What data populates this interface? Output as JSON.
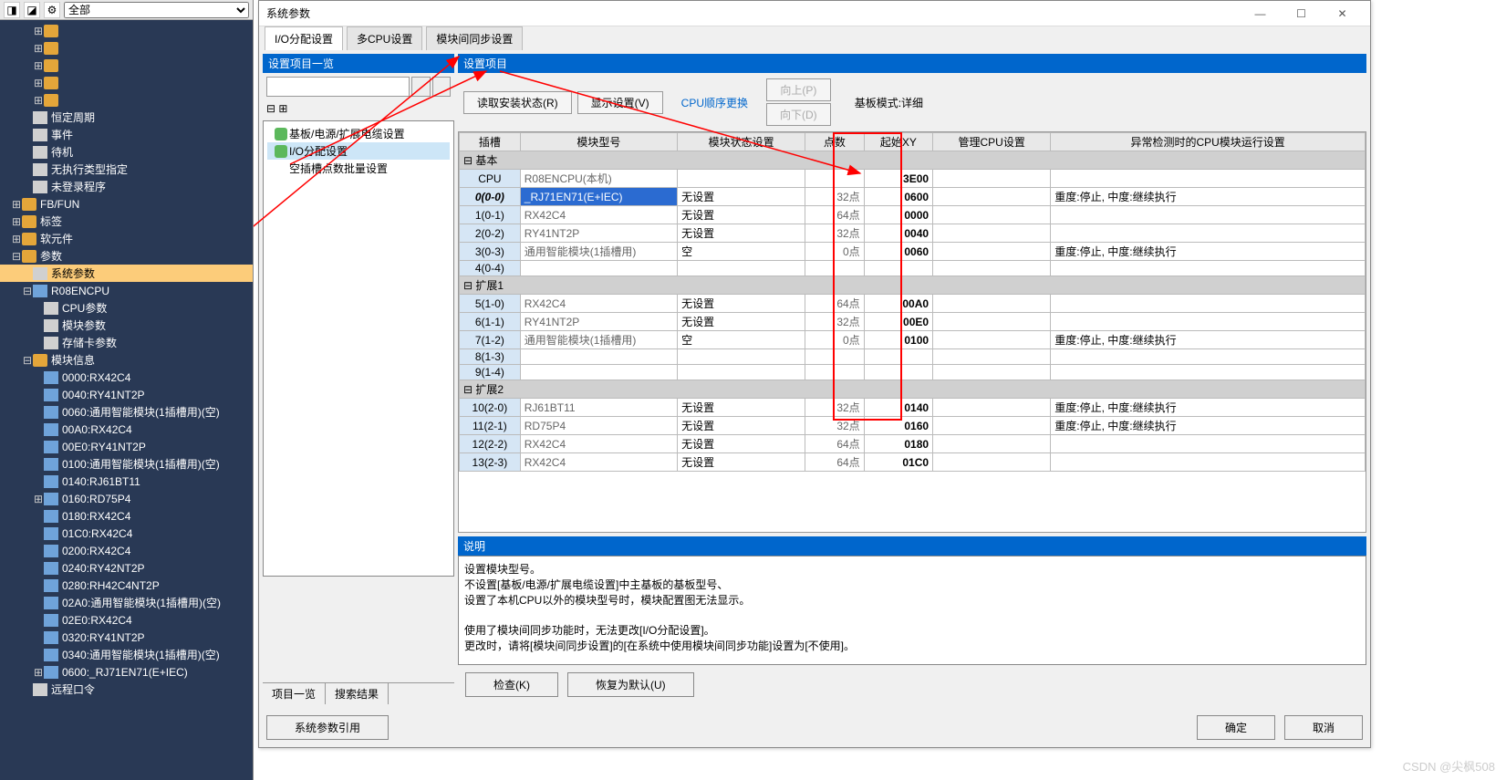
{
  "nav": {
    "dropdown": "全部",
    "items": [
      {
        "pad": 30,
        "pm": "⊞",
        "icon": "ic-folder",
        "label": ""
      },
      {
        "pad": 30,
        "pm": "⊞",
        "icon": "ic-folder",
        "label": ""
      },
      {
        "pad": 30,
        "pm": "⊞",
        "icon": "ic-folder",
        "label": ""
      },
      {
        "pad": 30,
        "pm": "⊞",
        "icon": "ic-folder",
        "label": ""
      },
      {
        "pad": 30,
        "pm": "⊞",
        "icon": "ic-folder",
        "label": ""
      },
      {
        "pad": 18,
        "pm": "",
        "icon": "ic-page",
        "label": "恒定周期"
      },
      {
        "pad": 18,
        "pm": "",
        "icon": "ic-page",
        "label": "事件"
      },
      {
        "pad": 18,
        "pm": "",
        "icon": "ic-page",
        "label": "待机"
      },
      {
        "pad": 18,
        "pm": "",
        "icon": "ic-page",
        "label": "无执行类型指定"
      },
      {
        "pad": 18,
        "pm": "",
        "icon": "ic-page",
        "label": "未登录程序"
      },
      {
        "pad": 6,
        "pm": "⊞",
        "icon": "ic-folder",
        "label": "FB/FUN"
      },
      {
        "pad": 6,
        "pm": "⊞",
        "icon": "ic-folder",
        "label": "标签"
      },
      {
        "pad": 6,
        "pm": "⊞",
        "icon": "ic-folder",
        "label": "软元件"
      },
      {
        "pad": 6,
        "pm": "⊟",
        "icon": "ic-folder",
        "label": "参数"
      },
      {
        "pad": 18,
        "pm": "",
        "icon": "ic-page",
        "label": "系统参数",
        "sel": true
      },
      {
        "pad": 18,
        "pm": "⊟",
        "icon": "ic-mod",
        "label": "R08ENCPU"
      },
      {
        "pad": 30,
        "pm": "",
        "icon": "ic-page",
        "label": "CPU参数"
      },
      {
        "pad": 30,
        "pm": "",
        "icon": "ic-page",
        "label": "模块参数"
      },
      {
        "pad": 30,
        "pm": "",
        "icon": "ic-page",
        "label": "存储卡参数"
      },
      {
        "pad": 18,
        "pm": "⊟",
        "icon": "ic-folder",
        "label": "模块信息"
      },
      {
        "pad": 30,
        "pm": "",
        "icon": "ic-mod",
        "label": "0000:RX42C4"
      },
      {
        "pad": 30,
        "pm": "",
        "icon": "ic-mod",
        "label": "0040:RY41NT2P"
      },
      {
        "pad": 30,
        "pm": "",
        "icon": "ic-mod",
        "label": "0060:通用智能模块(1插槽用)(空)"
      },
      {
        "pad": 30,
        "pm": "",
        "icon": "ic-mod",
        "label": "00A0:RX42C4"
      },
      {
        "pad": 30,
        "pm": "",
        "icon": "ic-mod",
        "label": "00E0:RY41NT2P"
      },
      {
        "pad": 30,
        "pm": "",
        "icon": "ic-mod",
        "label": "0100:通用智能模块(1插槽用)(空)"
      },
      {
        "pad": 30,
        "pm": "",
        "icon": "ic-mod",
        "label": "0140:RJ61BT11"
      },
      {
        "pad": 30,
        "pm": "⊞",
        "icon": "ic-mod",
        "label": "0160:RD75P4"
      },
      {
        "pad": 30,
        "pm": "",
        "icon": "ic-mod",
        "label": "0180:RX42C4"
      },
      {
        "pad": 30,
        "pm": "",
        "icon": "ic-mod",
        "label": "01C0:RX42C4"
      },
      {
        "pad": 30,
        "pm": "",
        "icon": "ic-mod",
        "label": "0200:RX42C4"
      },
      {
        "pad": 30,
        "pm": "",
        "icon": "ic-mod",
        "label": "0240:RY42NT2P"
      },
      {
        "pad": 30,
        "pm": "",
        "icon": "ic-mod",
        "label": "0280:RH42C4NT2P"
      },
      {
        "pad": 30,
        "pm": "",
        "icon": "ic-mod",
        "label": "02A0:通用智能模块(1插槽用)(空)"
      },
      {
        "pad": 30,
        "pm": "",
        "icon": "ic-mod",
        "label": "02E0:RX42C4"
      },
      {
        "pad": 30,
        "pm": "",
        "icon": "ic-mod",
        "label": "0320:RY41NT2P"
      },
      {
        "pad": 30,
        "pm": "",
        "icon": "ic-mod",
        "label": "0340:通用智能模块(1插槽用)(空)"
      },
      {
        "pad": 30,
        "pm": "⊞",
        "icon": "ic-mod",
        "label": "0600:_RJ71EN71(E+IEC)"
      },
      {
        "pad": 18,
        "pm": "",
        "icon": "ic-page",
        "label": "远程口令"
      }
    ]
  },
  "dlg": {
    "title": "系统参数",
    "tabs": [
      "I/O分配设置",
      "多CPU设置",
      "模块间同步设置"
    ],
    "left_head": "设置项目一览",
    "tree": [
      {
        "label": "基板/电源/扩展电缆设置",
        "chk": true
      },
      {
        "label": "I/O分配设置",
        "chk": true,
        "sel": true
      },
      {
        "label": "空插槽点数批量设置",
        "chk": false
      }
    ],
    "btabs": [
      "项目一览",
      "搜索结果"
    ],
    "right_head": "设置项目",
    "btns": {
      "read": "读取安装状态(R)",
      "disp": "显示设置(V)",
      "order": "CPU顺序更换",
      "up": "向上(P)",
      "down": "向下(D)"
    },
    "mode": "基板模式:详细",
    "cols": [
      "插槽",
      "模块型号",
      "模块状态设置",
      "点数",
      "起始XY",
      "管理CPU设置",
      "异常检测时的CPU模块运行设置"
    ],
    "rows": [
      {
        "g": true,
        "slot": "基本"
      },
      {
        "slot": "CPU",
        "model": "R08ENCPU(本机)",
        "stat": "",
        "pts": "",
        "xy": "3E00",
        "cpu": "",
        "err": ""
      },
      {
        "hl": true,
        "slot": "0(0-0)",
        "model": "_RJ71EN71(E+IEC)",
        "stat": "无设置",
        "pts": "32点",
        "xy": "0600",
        "cpu": "",
        "err": "重度:停止, 中度:继续执行"
      },
      {
        "slot": "1(0-1)",
        "model": "RX42C4",
        "stat": "无设置",
        "pts": "64点",
        "xy": "0000",
        "cpu": "",
        "err": ""
      },
      {
        "slot": "2(0-2)",
        "model": "RY41NT2P",
        "stat": "无设置",
        "pts": "32点",
        "xy": "0040",
        "cpu": "",
        "err": ""
      },
      {
        "slot": "3(0-3)",
        "model": "通用智能模块(1插槽用)",
        "stat": "空",
        "pts": "0点",
        "xy": "0060",
        "cpu": "",
        "err": "重度:停止, 中度:继续执行"
      },
      {
        "slot": "4(0-4)",
        "model": "",
        "stat": "",
        "pts": "",
        "xy": "",
        "cpu": "",
        "err": ""
      },
      {
        "g": true,
        "slot": "扩展1"
      },
      {
        "slot": "5(1-0)",
        "model": "RX42C4",
        "stat": "无设置",
        "pts": "64点",
        "xy": "00A0",
        "cpu": "",
        "err": ""
      },
      {
        "slot": "6(1-1)",
        "model": "RY41NT2P",
        "stat": "无设置",
        "pts": "32点",
        "xy": "00E0",
        "cpu": "",
        "err": ""
      },
      {
        "slot": "7(1-2)",
        "model": "通用智能模块(1插槽用)",
        "stat": "空",
        "pts": "0点",
        "xy": "0100",
        "cpu": "",
        "err": "重度:停止, 中度:继续执行"
      },
      {
        "slot": "8(1-3)",
        "model": "",
        "stat": "",
        "pts": "",
        "xy": "",
        "cpu": "",
        "err": ""
      },
      {
        "slot": "9(1-4)",
        "model": "",
        "stat": "",
        "pts": "",
        "xy": "",
        "cpu": "",
        "err": ""
      },
      {
        "g": true,
        "slot": "扩展2"
      },
      {
        "slot": "10(2-0)",
        "model": "RJ61BT11",
        "stat": "无设置",
        "pts": "32点",
        "xy": "0140",
        "cpu": "",
        "err": "重度:停止, 中度:继续执行"
      },
      {
        "slot": "11(2-1)",
        "model": "RD75P4",
        "stat": "无设置",
        "pts": "32点",
        "xy": "0160",
        "cpu": "",
        "err": "重度:停止, 中度:继续执行"
      },
      {
        "slot": "12(2-2)",
        "model": "RX42C4",
        "stat": "无设置",
        "pts": "64点",
        "xy": "0180",
        "cpu": "",
        "err": ""
      },
      {
        "slot": "13(2-3)",
        "model": "RX42C4",
        "stat": "无设置",
        "pts": "64点",
        "xy": "01C0",
        "cpu": "",
        "err": ""
      }
    ],
    "desc_head": "说明",
    "desc": "设置模块型号。\n不设置[基板/电源/扩展电缆设置]中主基板的基板型号、\n设置了本机CPU以外的模块型号时，模块配置图无法显示。\n\n使用了模块间同步功能时，无法更改[I/O分配设置]。\n更改时，请将[模块间同步设置]的[在系统中使用模块间同步功能]设置为[不使用]。",
    "chk": "检查(K)",
    "restore": "恢复为默认(U)",
    "import": "系统参数引用",
    "ok": "确定",
    "cancel": "取消"
  },
  "watermark": "CSDN @尖枫508"
}
